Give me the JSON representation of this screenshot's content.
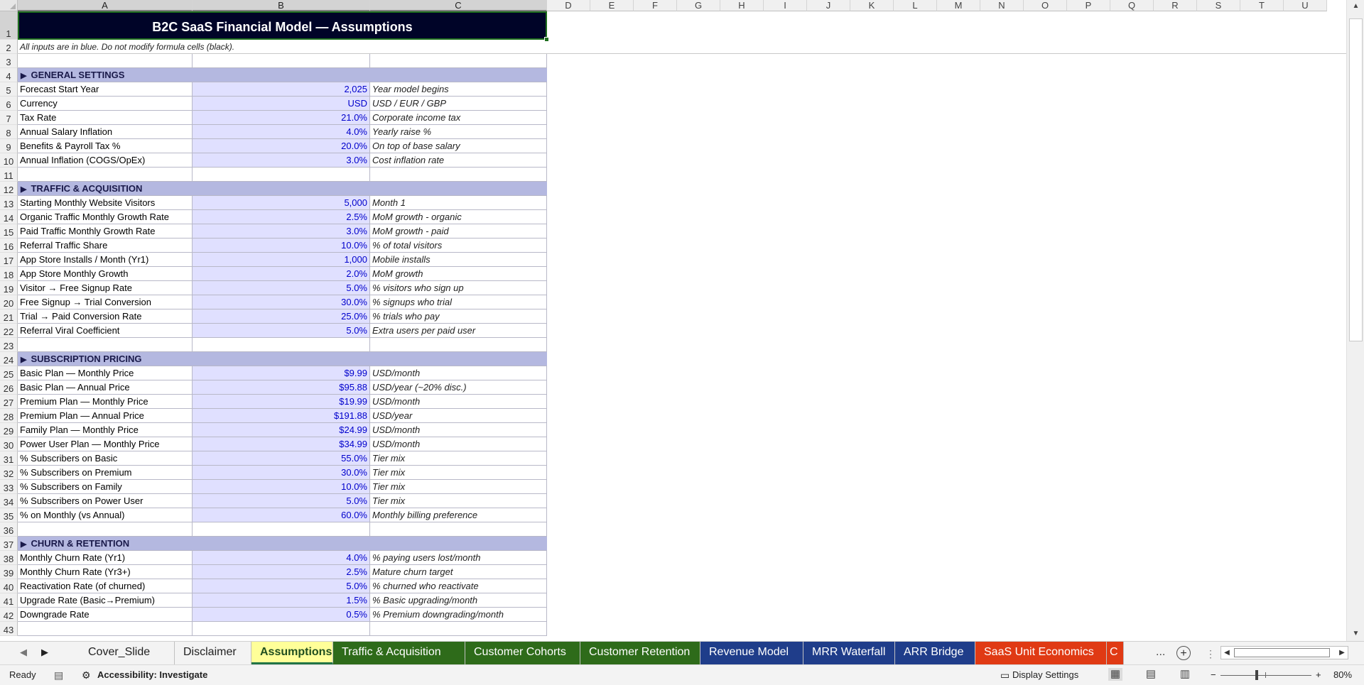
{
  "columns": [
    "A",
    "B",
    "C",
    "D",
    "E",
    "F",
    "G",
    "H",
    "I",
    "J",
    "K",
    "L",
    "M",
    "N",
    "O",
    "P",
    "Q",
    "R",
    "S",
    "T",
    "U"
  ],
  "title": "B2C SaaS Financial Model — Assumptions",
  "note": "All inputs are in blue. Do not modify formula cells (black).",
  "rows": [
    {
      "n": "1",
      "kind": "title"
    },
    {
      "n": "2",
      "kind": "note"
    },
    {
      "n": "3",
      "kind": "blank"
    },
    {
      "n": "4",
      "kind": "section",
      "label": "GENERAL SETTINGS"
    },
    {
      "n": "5",
      "kind": "data",
      "label": "Forecast Start Year",
      "value": "2,025",
      "desc": "Year model begins"
    },
    {
      "n": "6",
      "kind": "data",
      "label": "Currency",
      "value": "USD",
      "desc": "USD / EUR / GBP"
    },
    {
      "n": "7",
      "kind": "data",
      "label": "Tax Rate",
      "value": "21.0%",
      "desc": "Corporate income tax"
    },
    {
      "n": "8",
      "kind": "data",
      "label": "Annual Salary Inflation",
      "value": "4.0%",
      "desc": "Yearly raise %"
    },
    {
      "n": "9",
      "kind": "data",
      "label": "Benefits & Payroll Tax %",
      "value": "20.0%",
      "desc": "On top of base salary"
    },
    {
      "n": "10",
      "kind": "data",
      "label": "Annual Inflation (COGS/OpEx)",
      "value": "3.0%",
      "desc": "Cost inflation rate"
    },
    {
      "n": "11",
      "kind": "blank"
    },
    {
      "n": "12",
      "kind": "section",
      "label": "TRAFFIC & ACQUISITION"
    },
    {
      "n": "13",
      "kind": "data",
      "label": "Starting Monthly Website Visitors",
      "value": "5,000",
      "desc": "Month 1"
    },
    {
      "n": "14",
      "kind": "data",
      "label": "Organic Traffic Monthly Growth Rate",
      "value": "2.5%",
      "desc": "MoM growth - organic"
    },
    {
      "n": "15",
      "kind": "data",
      "label": "Paid Traffic Monthly Growth Rate",
      "value": "3.0%",
      "desc": "MoM growth - paid"
    },
    {
      "n": "16",
      "kind": "data",
      "label": "Referral Traffic Share",
      "value": "10.0%",
      "desc": "% of total visitors"
    },
    {
      "n": "17",
      "kind": "data",
      "label": "App Store Installs / Month (Yr1)",
      "value": "1,000",
      "desc": "Mobile installs"
    },
    {
      "n": "18",
      "kind": "data",
      "label": "App Store Monthly Growth",
      "value": "2.0%",
      "desc": "MoM growth"
    },
    {
      "n": "19",
      "kind": "data",
      "label": "Visitor → Free Signup Rate",
      "value": "5.0%",
      "desc": "% visitors who sign up"
    },
    {
      "n": "20",
      "kind": "data",
      "label": "Free Signup → Trial Conversion",
      "value": "30.0%",
      "desc": "% signups who trial"
    },
    {
      "n": "21",
      "kind": "data",
      "label": "Trial → Paid Conversion Rate",
      "value": "25.0%",
      "desc": "% trials who pay"
    },
    {
      "n": "22",
      "kind": "data",
      "label": "Referral Viral Coefficient",
      "value": "5.0%",
      "desc": "Extra users per paid user"
    },
    {
      "n": "23",
      "kind": "blank"
    },
    {
      "n": "24",
      "kind": "section",
      "label": "SUBSCRIPTION PRICING"
    },
    {
      "n": "25",
      "kind": "data",
      "label": "Basic Plan — Monthly Price",
      "value": "$9.99",
      "desc": "USD/month"
    },
    {
      "n": "26",
      "kind": "data",
      "label": "Basic Plan — Annual Price",
      "value": "$95.88",
      "desc": "USD/year (~20% disc.)"
    },
    {
      "n": "27",
      "kind": "data",
      "label": "Premium Plan — Monthly Price",
      "value": "$19.99",
      "desc": "USD/month"
    },
    {
      "n": "28",
      "kind": "data",
      "label": "Premium Plan — Annual Price",
      "value": "$191.88",
      "desc": "USD/year"
    },
    {
      "n": "29",
      "kind": "data",
      "label": "Family Plan — Monthly Price",
      "value": "$24.99",
      "desc": "USD/month"
    },
    {
      "n": "30",
      "kind": "data",
      "label": "Power User Plan — Monthly Price",
      "value": "$34.99",
      "desc": "USD/month"
    },
    {
      "n": "31",
      "kind": "data",
      "label": "% Subscribers on Basic",
      "value": "55.0%",
      "desc": "Tier mix"
    },
    {
      "n": "32",
      "kind": "data",
      "label": "% Subscribers on Premium",
      "value": "30.0%",
      "desc": "Tier mix"
    },
    {
      "n": "33",
      "kind": "data",
      "label": "% Subscribers on Family",
      "value": "10.0%",
      "desc": "Tier mix"
    },
    {
      "n": "34",
      "kind": "data",
      "label": "% Subscribers on Power User",
      "value": "5.0%",
      "desc": "Tier mix"
    },
    {
      "n": "35",
      "kind": "data",
      "label": "% on Monthly (vs Annual)",
      "value": "60.0%",
      "desc": "Monthly billing preference"
    },
    {
      "n": "36",
      "kind": "blank"
    },
    {
      "n": "37",
      "kind": "section",
      "label": "CHURN & RETENTION"
    },
    {
      "n": "38",
      "kind": "data",
      "label": "Monthly Churn Rate (Yr1)",
      "value": "4.0%",
      "desc": "% paying users lost/month"
    },
    {
      "n": "39",
      "kind": "data",
      "label": "Monthly Churn Rate (Yr3+)",
      "value": "2.5%",
      "desc": "Mature churn target"
    },
    {
      "n": "40",
      "kind": "data",
      "label": "Reactivation Rate (of churned)",
      "value": "5.0%",
      "desc": "% churned who reactivate"
    },
    {
      "n": "41",
      "kind": "data",
      "label": "Upgrade Rate (Basic→Premium)",
      "value": "1.5%",
      "desc": "% Basic upgrading/month"
    },
    {
      "n": "42",
      "kind": "data",
      "label": "Downgrade Rate",
      "value": "0.5%",
      "desc": "% Premium downgrading/month"
    },
    {
      "n": "43",
      "kind": "blank"
    }
  ],
  "sheet_tabs": [
    {
      "label": "Cover_Slide",
      "bg": "#f3f3f3",
      "fg": "#222222",
      "active": false
    },
    {
      "label": "Disclaimer",
      "bg": "#f3f3f3",
      "fg": "#222222",
      "active": false
    },
    {
      "label": "Assumptions",
      "bg": "#ffff99",
      "fg": "#1f4e1f",
      "active": true
    },
    {
      "label": "Traffic & Acquisition",
      "bg": "#2e6b1a",
      "fg": "#ffffff",
      "active": false
    },
    {
      "label": "Customer Cohorts",
      "bg": "#2e6b1a",
      "fg": "#ffffff",
      "active": false
    },
    {
      "label": "Customer Retention",
      "bg": "#2e6b1a",
      "fg": "#ffffff",
      "active": false
    },
    {
      "label": "Revenue Model",
      "bg": "#1f3d8a",
      "fg": "#ffffff",
      "active": false
    },
    {
      "label": "MRR Waterfall",
      "bg": "#1f3d8a",
      "fg": "#ffffff",
      "active": false
    },
    {
      "label": "ARR Bridge",
      "bg": "#1f3d8a",
      "fg": "#ffffff",
      "active": false
    },
    {
      "label": "SaaS Unit Economics",
      "bg": "#e03a14",
      "fg": "#ffffff",
      "active": false
    },
    {
      "label": "C",
      "bg": "#e03a14",
      "fg": "#ffffff",
      "active": false
    }
  ],
  "tab_ellipsis": "...",
  "add_sheet": "+",
  "status": {
    "ready": "Ready",
    "accessibility": "Accessibility: Investigate",
    "display_settings": "Display Settings",
    "zoom_minus": "−",
    "zoom_plus": "+",
    "zoom": "80%"
  },
  "icons": {
    "macro": "macro-record-icon",
    "accessibility": "accessibility-icon",
    "display": "display-settings-icon",
    "normal_view": "normal-view-icon",
    "page_layout": "page-layout-view-icon",
    "page_break": "page-break-view-icon"
  },
  "colors": {
    "title_bg": "#000428",
    "section_bg": "#b4b8e0",
    "input_bg": "#e0e0ff",
    "input_text": "#0000cc"
  }
}
